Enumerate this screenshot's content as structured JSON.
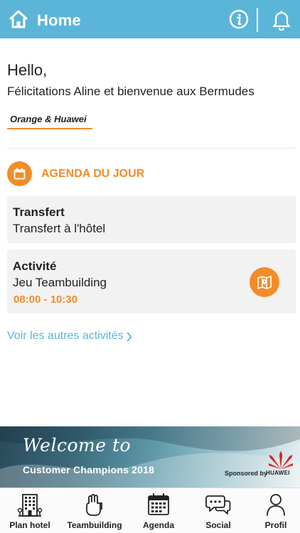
{
  "header": {
    "title": "Home",
    "bg_color": "#5bb5d9",
    "icons": [
      "home-icon",
      "info-icon",
      "bell-icon"
    ]
  },
  "greeting": "Hello,",
  "welcome_text": "Félicitations Aline et bienvenue aux Bermudes",
  "tag_label": "Orange & Huawei",
  "agenda": {
    "heading": "AGENDA DU JOUR",
    "accent_color": "#f28c28",
    "items": [
      {
        "title": "Transfert",
        "subtitle": "Transfert à l'hôtel"
      },
      {
        "title": "Activité",
        "subtitle": "Jeu Teambuilding",
        "time": "08:00 - 10:30"
      }
    ],
    "more_link": "Voir les autres activités"
  },
  "banner": {
    "script_text": "Welcome to",
    "event_text": "Customer Champions 2018",
    "sponsored_text": "Sponsored by",
    "sponsor_name": "HUAWEI"
  },
  "tabbar": {
    "tabs": [
      {
        "label": "Plan hotel",
        "icon": "building-icon"
      },
      {
        "label": "Teambuilding",
        "icon": "teambuilding-icon"
      },
      {
        "label": "Agenda",
        "icon": "calendar-icon"
      },
      {
        "label": "Social",
        "icon": "chat-bubbles-icon"
      },
      {
        "label": "Profil",
        "icon": "person-icon"
      }
    ]
  }
}
